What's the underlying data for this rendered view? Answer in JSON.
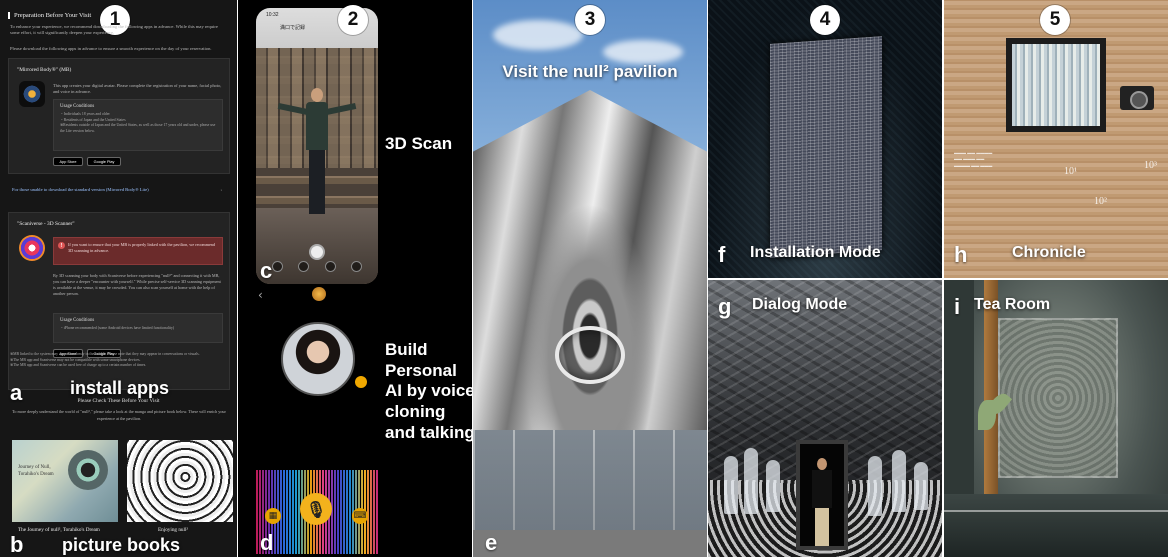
{
  "panels": {
    "p1": {
      "number": "1",
      "preparation_title": "Preparation Before Your Visit",
      "intro_text": "To enhance your experience, we recommend downloading the following apps in advance. While this may require some effort, it will significantly deepen your experience.",
      "download_text": "Please download the following apps in advance to ensure a smooth experience on the day of your reservation.",
      "app1": {
        "title": "\"Mirrored Body®\" (MB)",
        "description": "This app creates your digital avatar. Please complete the registration of your name, facial photo, and voice in advance.",
        "conditions_title": "Usage Conditions",
        "conditions": [
          "・Individuals 18 years and older",
          "・Residents of Japan and the United States",
          "※Residents outside of Japan and the United States, as well as those 17 years old and under, please use the Lite version below."
        ],
        "app_store": "App Store",
        "google_play": "Google Play"
      },
      "lite_link": "For those unable to download the standard version (Mirrored Body® Lite)",
      "app2": {
        "title": "\"Scaniverse - 3D Scanner\"",
        "warning": "If you want to ensure that your MB is properly linked with the pavilion, we recommend 3D scanning in advance.",
        "description": "By 3D scanning your body with Scaniverse before experiencing \"null²\" and connecting it with MB, you can have a deeper \"encounter with yourself.\" While precise self-service 3D scanning equipment is available at the venue, it may be crowded. You can also scan yourself at home with the help of another person.",
        "conditions_title": "Usage Conditions",
        "conditions": [
          "・iPhone recommended (some Android devices have limited functionality)"
        ],
        "app_store": "App Store",
        "google_play": "Google Play"
      },
      "notes": [
        "※MB linked to the system may appear randomly in the exhibit. Please note that they may appear in conversations or visuals.",
        "※The MB app and Scaniverse may not be compatible with some smartphone devices.",
        "※The MB app and Scaniverse can be used free of charge up to a certain number of times."
      ],
      "label_a": "a",
      "caption_a": "install apps",
      "lower_heading": "Please Check These Before Your Visit",
      "lower_text": "To more deeply understand the world of \"null²,\" please take a look at the manga and picture book below. These will enrich your experience at the pavilion.",
      "book1_cover": "Journey of Null,\nTorahiko's Dream",
      "book1_name": "The Journey of null², Torahiko's Dream",
      "book2_name": "Enjoying null²",
      "label_b": "b",
      "caption_b": "picture books"
    },
    "p2": {
      "number": "2",
      "status_time": "10:32",
      "phone_title": "満口で記録",
      "label_c": "c",
      "caption_scan": "3D Scan",
      "back_glyph": "‹",
      "caption_ai": "Build Personal AI by voice cloning and talking",
      "label_d": "d",
      "mic_glyph": "🎙",
      "left_btn_glyph": "▦",
      "right_btn_glyph": "⌨"
    },
    "p3": {
      "number": "3",
      "caption": "Visit the null² pavilion",
      "label_e": "e"
    },
    "p4": {
      "number": "4",
      "label_f": "f",
      "caption_f": "Installation Mode",
      "label_g": "g",
      "caption_g": "Dialog Mode"
    },
    "p5": {
      "number": "5",
      "label_h": "h",
      "caption_h": "Chronicle",
      "exponent_1": "10¹",
      "exponent_2": "10²",
      "exponent_3": "10³",
      "label_i": "i",
      "caption_i": "Tea Room"
    }
  }
}
